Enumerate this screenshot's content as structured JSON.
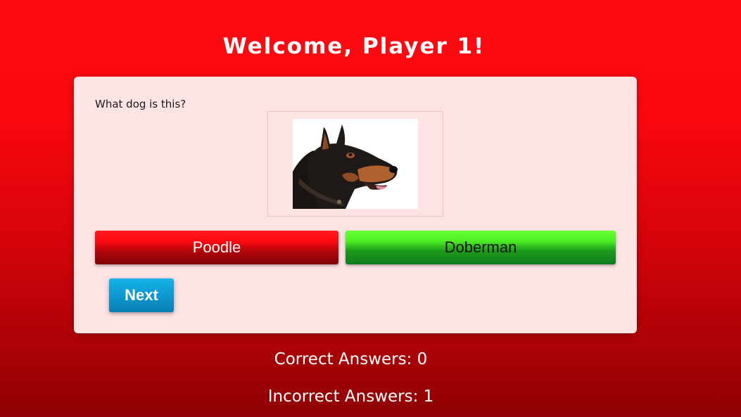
{
  "header": {
    "title": "Welcome, Player 1!"
  },
  "quiz": {
    "question": "What dog is this?",
    "image_icon": "doberman-photo",
    "answers": [
      {
        "label": "Poodle",
        "status": "incorrect",
        "color": "#ff0a12"
      },
      {
        "label": "Doberman",
        "status": "correct",
        "color": "#4fef25"
      }
    ],
    "next_label": "Next"
  },
  "score": {
    "correct_text": "Correct Answers: 0",
    "incorrect_text": "Incorrect Answers: 1"
  },
  "colors": {
    "background": "#ff0a12",
    "card": "#fde3e4",
    "next_button": "#0e9bd4"
  }
}
